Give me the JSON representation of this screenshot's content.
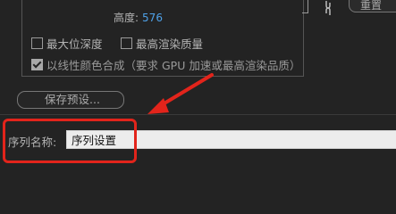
{
  "video_settings": {
    "height_label": "高度:",
    "height_value": "576"
  },
  "toolbar": {
    "reset_label": "重置"
  },
  "options": {
    "max_bit_depth": {
      "label": "最大位深度",
      "checked": false
    },
    "max_render_quality": {
      "label": "最高渲染质量",
      "checked": false
    },
    "linear_color": {
      "label": "以线性颜色合成（要求 GPU 加速或最高渲染品质）",
      "checked": true
    }
  },
  "presets": {
    "save_label": "保存预设..."
  },
  "sequence": {
    "name_label": "序列名称:",
    "name_value": "序列设置"
  },
  "colors": {
    "background": "#232323",
    "accent_value": "#4ea1e8",
    "annotation": "#e2241b",
    "input_bg": "#ececec"
  }
}
